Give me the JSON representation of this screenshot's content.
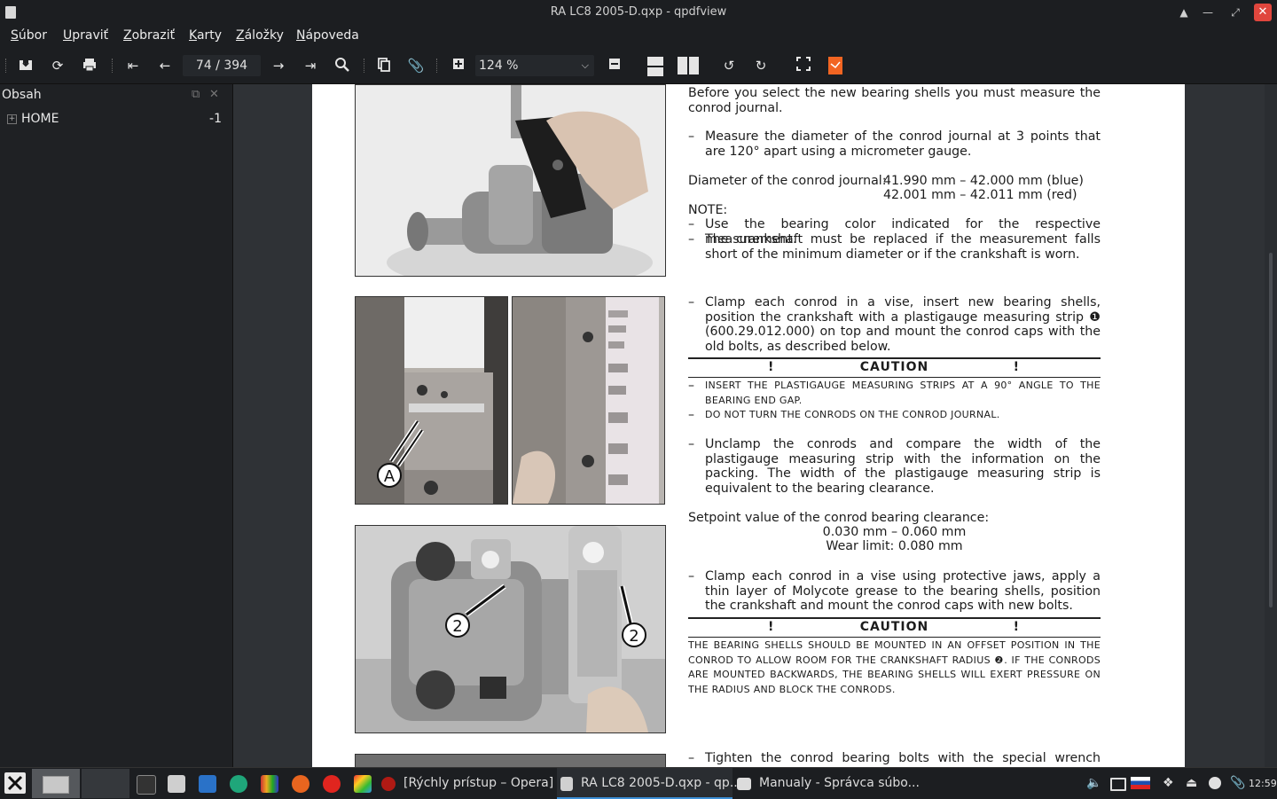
{
  "window": {
    "title": "RA LC8 2005-D.qxp - qpdfview"
  },
  "menu": {
    "items": [
      {
        "label": "Súbor",
        "ul": "S",
        "rest": "úbor"
      },
      {
        "label": "Upraviť",
        "ul": "U",
        "rest": "praviť"
      },
      {
        "label": "Zobraziť",
        "ul": "Z",
        "rest": "obraziť"
      },
      {
        "label": "Karty",
        "ul": "K",
        "rest": "arty"
      },
      {
        "label": "Záložky",
        "ul": "Z",
        "rest": "áložky"
      },
      {
        "label": "Nápoveda",
        "ul": "N",
        "rest": "ápoveda"
      }
    ]
  },
  "toolbar": {
    "page_indicator": "74 / 394",
    "zoom": "124 %"
  },
  "sidebar": {
    "title": "Obsah",
    "items": [
      {
        "label": "HOME",
        "page": "-1"
      }
    ]
  },
  "document": {
    "p1": "Before you select the new bearing shells you must measure the conrod journal.",
    "b1": "Measure the diameter of the conrod journal at 3 points that are 120° apart using a micrometer gauge.",
    "diam_label": "Diameter of the conrod journal:",
    "diam_blue": "41.990 mm – 42.000 mm (blue)",
    "diam_red": "42.001 mm – 42.011 mm (red)",
    "note": "NOTE:",
    "n1": "Use the bearing color indicated for the respective measurement.",
    "n2": "The crankshaft must be replaced if the measurement falls short of the minimum diameter or if the crankshaft is worn.",
    "b2": "Clamp each conrod in a vise, insert new bearing shells, position the crankshaft with a plastigauge measuring strip ❶ (600.29.012.000) on top and mount the conrod caps with the old bolts, as described below.",
    "caution_word": "CAUTION",
    "caution_mark": "!",
    "c1": "Insert the plastigauge measuring strips at a 90° angle to the bearing end gap.",
    "c2": "Do not turn the conrods on the conrod journal.",
    "b3": "Unclamp the conrods and compare the width of the plastigauge measuring strip with the information on the packing. The width of the plastigauge measuring strip is equivalent to the bearing clearance.",
    "setpoint_label": "Setpoint value of the conrod bearing clearance:",
    "setpoint_value": "0.030 mm – 0.060 mm",
    "wear_limit": "Wear limit: 0.080 mm",
    "b4": "Clamp each conrod in a vise using protective jaws, apply a thin layer of Molycote grease to the bearing shells, position the crankshaft and mount the conrod caps with new bolts.",
    "c3": "The bearing shells should be mounted in an offset position in the conrod to allow room for the crankshaft radius ❷. If the conrods are mounted backwards, the bearing shells will exert pressure on the radius and block the conrods.",
    "b5": "Tighten the conrod bearing bolts with the special wrench socket",
    "callout_a": "A",
    "callout_2": "2"
  },
  "taskbar": {
    "opera_label": "[Rýchly prístup – Opera]",
    "qpdf_label": "RA LC8 2005-D.qxp - qp...",
    "files_label": "Manualy - Správca súbo...",
    "clock": "12:59"
  }
}
